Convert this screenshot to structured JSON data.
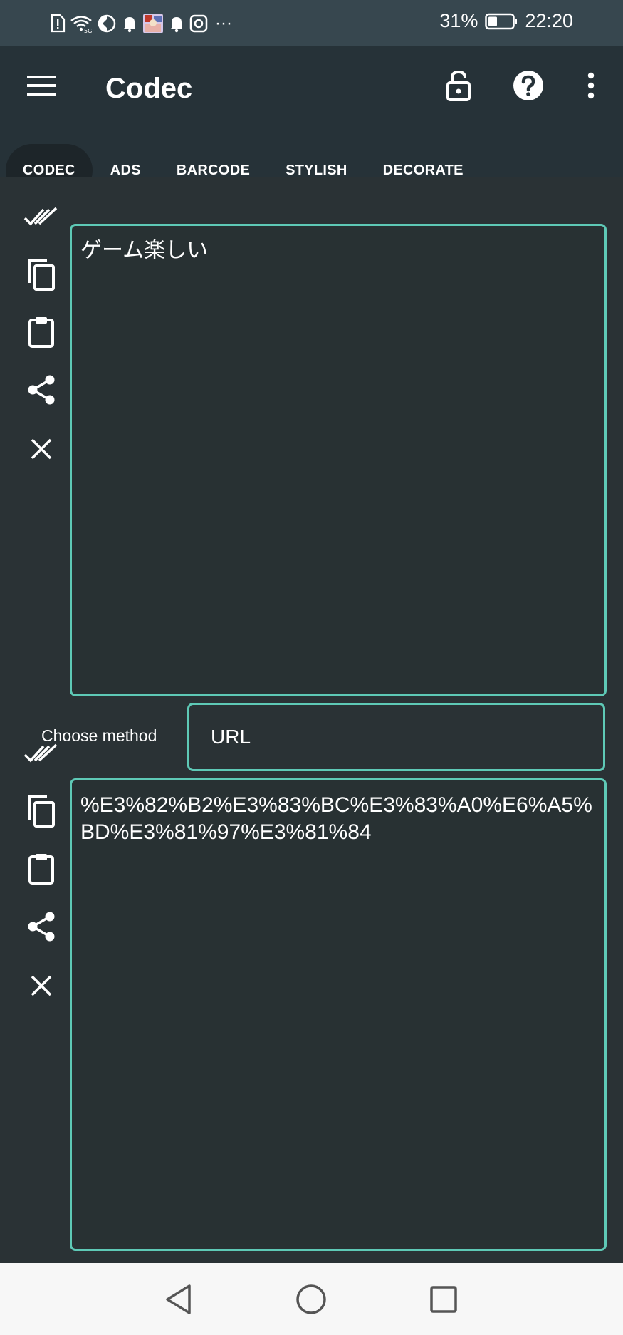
{
  "status_bar": {
    "battery_percent": "31%",
    "time": "22:20",
    "more_notifications": "···"
  },
  "app_bar": {
    "title": "Codec"
  },
  "tabs": [
    {
      "label": "CODEC",
      "active": true
    },
    {
      "label": "ADS",
      "active": false
    },
    {
      "label": "BARCODE",
      "active": false
    },
    {
      "label": "STYLISH",
      "active": false
    },
    {
      "label": "DECORATE",
      "active": false
    }
  ],
  "input": {
    "value": "ゲーム楽しい"
  },
  "method": {
    "label": "Choose method",
    "selected": "URL"
  },
  "output": {
    "value": "%E3%82%B2%E3%83%BC%E3%83%A0%E6%A5%BD%E3%81%97%E3%81%84"
  },
  "colors": {
    "accent": "#5ec9b6",
    "background": "#2a3235",
    "app_bar": "#263238",
    "status_bar": "#37474f"
  },
  "icons": {
    "app_bar": [
      "menu-icon",
      "lock-open-icon",
      "help-icon",
      "more-vert-icon"
    ],
    "side_actions": [
      "select-all-icon",
      "copy-icon",
      "paste-icon",
      "share-icon",
      "clear-icon"
    ],
    "navigation": [
      "back-icon",
      "home-icon",
      "recents-icon"
    ]
  }
}
